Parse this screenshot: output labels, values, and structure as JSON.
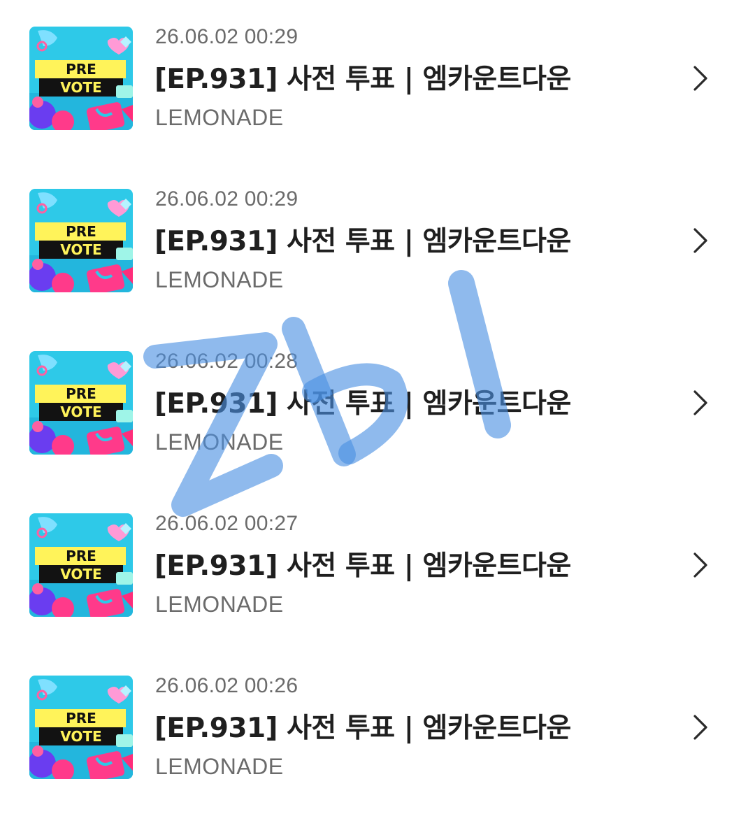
{
  "list": {
    "items": [
      {
        "timestamp": "26.06.02 00:29",
        "title": "[EP.931] 사전 투표 | 엠카운트다운",
        "artist": "LEMONADE"
      },
      {
        "timestamp": "26.06.02 00:29",
        "title": "[EP.931] 사전 투표 | 엠카운트다운",
        "artist": "LEMONADE"
      },
      {
        "timestamp": "26.06.02 00:28",
        "title": "[EP.931] 사전 투표 | 엠카운트다운",
        "artist": "LEMONADE"
      },
      {
        "timestamp": "26.06.02 00:27",
        "title": "[EP.931] 사전 투표 | 엠카운트다운",
        "artist": "LEMONADE"
      },
      {
        "timestamp": "26.06.02 00:26",
        "title": "[EP.931] 사전 투표 | 엠카운트다운",
        "artist": "LEMONADE"
      }
    ]
  },
  "thumbnail": {
    "line1": "PRE",
    "line2": "VOTE"
  },
  "icons": {
    "row_action": "chevron-right-icon"
  },
  "watermark": {
    "text": "Zbl",
    "color": "#4a90e2"
  },
  "colors": {
    "thumb_bg": "#2ec9e8",
    "thumb_banner": "#fff35a",
    "thumb_heart": "#ff7ec8",
    "thumb_pink": "#ff3a8a",
    "thumb_purple": "#6a3df0",
    "text_primary": "#1f1f1f",
    "text_secondary": "#6b6b6b"
  }
}
